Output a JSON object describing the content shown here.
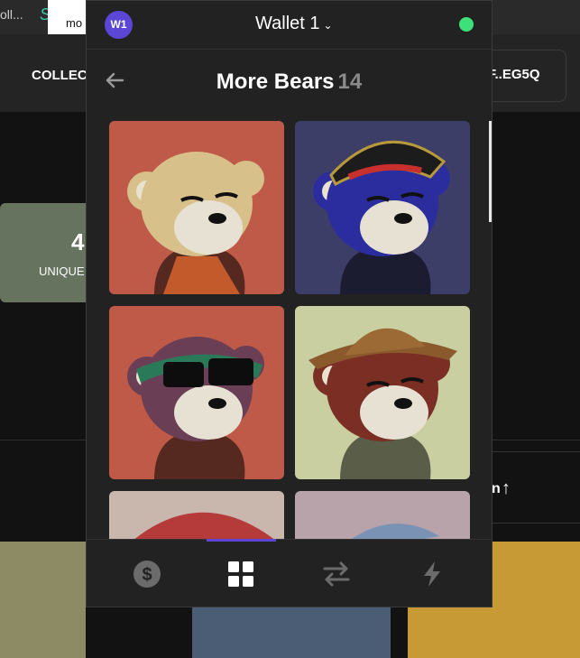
{
  "background": {
    "tab_left": "oll...",
    "tab_s": "S",
    "tooltip_text": "mo",
    "nav_collections": "COLLEC",
    "address_button": "F..EG5Q",
    "stat_value": "4",
    "stat_label": "UNIQUE",
    "sort_text": "n",
    "badge": "%"
  },
  "wallet": {
    "avatar_initials": "W1",
    "name": "Wallet 1",
    "status_color": "#3ee07a"
  },
  "collection": {
    "title": "More Bears",
    "count": "14"
  },
  "nfts": [
    {
      "name": "bear-1",
      "bg": "#bf5a48",
      "fur": "#d8c08a",
      "accessory": "orange-jacket"
    },
    {
      "name": "bear-2",
      "bg": "#3d3e68",
      "fur": "#2b2d9e",
      "accessory": "pirate-hat"
    },
    {
      "name": "bear-3",
      "bg": "#bf5a48",
      "fur": "#6a3e55",
      "accessory": "bandana-sunglasses"
    },
    {
      "name": "bear-4",
      "bg": "#c9cfa1",
      "fur": "#7a2e24",
      "accessory": "cowboy-hat"
    },
    {
      "name": "bear-5",
      "bg": "#c9b7ad",
      "fur": "#c9b7ad",
      "accessory": "red-cap"
    },
    {
      "name": "bear-6",
      "bg": "#b8a3ab",
      "fur": "#b8a3ab",
      "accessory": "fish-hat"
    }
  ],
  "footer_tabs": [
    {
      "name": "balance-tab",
      "icon": "dollar-icon",
      "active": false
    },
    {
      "name": "collectibles-tab",
      "icon": "grid-icon",
      "active": true
    },
    {
      "name": "swap-tab",
      "icon": "swap-icon",
      "active": false
    },
    {
      "name": "activity-tab",
      "icon": "lightning-icon",
      "active": false
    }
  ],
  "colors": {
    "accent": "#5b46d6",
    "panel": "#222222",
    "muted": "#8b8b8b"
  }
}
